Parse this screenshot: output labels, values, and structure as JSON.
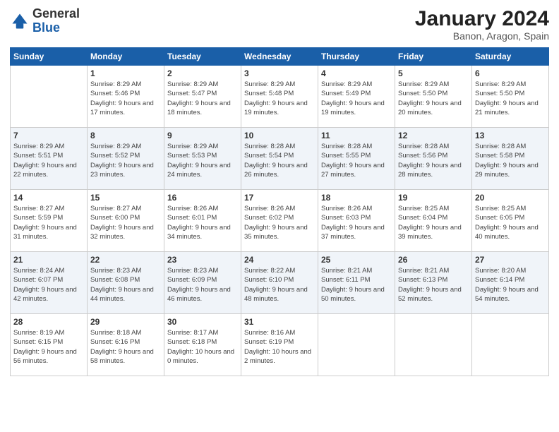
{
  "header": {
    "logo_general": "General",
    "logo_blue": "Blue",
    "title": "January 2024",
    "subtitle": "Banon, Aragon, Spain"
  },
  "days_of_week": [
    "Sunday",
    "Monday",
    "Tuesday",
    "Wednesday",
    "Thursday",
    "Friday",
    "Saturday"
  ],
  "weeks": [
    [
      {
        "day": null
      },
      {
        "day": "1",
        "sunrise": "Sunrise: 8:29 AM",
        "sunset": "Sunset: 5:46 PM",
        "daylight": "Daylight: 9 hours and 17 minutes."
      },
      {
        "day": "2",
        "sunrise": "Sunrise: 8:29 AM",
        "sunset": "Sunset: 5:47 PM",
        "daylight": "Daylight: 9 hours and 18 minutes."
      },
      {
        "day": "3",
        "sunrise": "Sunrise: 8:29 AM",
        "sunset": "Sunset: 5:48 PM",
        "daylight": "Daylight: 9 hours and 19 minutes."
      },
      {
        "day": "4",
        "sunrise": "Sunrise: 8:29 AM",
        "sunset": "Sunset: 5:49 PM",
        "daylight": "Daylight: 9 hours and 19 minutes."
      },
      {
        "day": "5",
        "sunrise": "Sunrise: 8:29 AM",
        "sunset": "Sunset: 5:50 PM",
        "daylight": "Daylight: 9 hours and 20 minutes."
      },
      {
        "day": "6",
        "sunrise": "Sunrise: 8:29 AM",
        "sunset": "Sunset: 5:50 PM",
        "daylight": "Daylight: 9 hours and 21 minutes."
      }
    ],
    [
      {
        "day": "7",
        "sunrise": "Sunrise: 8:29 AM",
        "sunset": "Sunset: 5:51 PM",
        "daylight": "Daylight: 9 hours and 22 minutes."
      },
      {
        "day": "8",
        "sunrise": "Sunrise: 8:29 AM",
        "sunset": "Sunset: 5:52 PM",
        "daylight": "Daylight: 9 hours and 23 minutes."
      },
      {
        "day": "9",
        "sunrise": "Sunrise: 8:29 AM",
        "sunset": "Sunset: 5:53 PM",
        "daylight": "Daylight: 9 hours and 24 minutes."
      },
      {
        "day": "10",
        "sunrise": "Sunrise: 8:28 AM",
        "sunset": "Sunset: 5:54 PM",
        "daylight": "Daylight: 9 hours and 26 minutes."
      },
      {
        "day": "11",
        "sunrise": "Sunrise: 8:28 AM",
        "sunset": "Sunset: 5:55 PM",
        "daylight": "Daylight: 9 hours and 27 minutes."
      },
      {
        "day": "12",
        "sunrise": "Sunrise: 8:28 AM",
        "sunset": "Sunset: 5:56 PM",
        "daylight": "Daylight: 9 hours and 28 minutes."
      },
      {
        "day": "13",
        "sunrise": "Sunrise: 8:28 AM",
        "sunset": "Sunset: 5:58 PM",
        "daylight": "Daylight: 9 hours and 29 minutes."
      }
    ],
    [
      {
        "day": "14",
        "sunrise": "Sunrise: 8:27 AM",
        "sunset": "Sunset: 5:59 PM",
        "daylight": "Daylight: 9 hours and 31 minutes."
      },
      {
        "day": "15",
        "sunrise": "Sunrise: 8:27 AM",
        "sunset": "Sunset: 6:00 PM",
        "daylight": "Daylight: 9 hours and 32 minutes."
      },
      {
        "day": "16",
        "sunrise": "Sunrise: 8:26 AM",
        "sunset": "Sunset: 6:01 PM",
        "daylight": "Daylight: 9 hours and 34 minutes."
      },
      {
        "day": "17",
        "sunrise": "Sunrise: 8:26 AM",
        "sunset": "Sunset: 6:02 PM",
        "daylight": "Daylight: 9 hours and 35 minutes."
      },
      {
        "day": "18",
        "sunrise": "Sunrise: 8:26 AM",
        "sunset": "Sunset: 6:03 PM",
        "daylight": "Daylight: 9 hours and 37 minutes."
      },
      {
        "day": "19",
        "sunrise": "Sunrise: 8:25 AM",
        "sunset": "Sunset: 6:04 PM",
        "daylight": "Daylight: 9 hours and 39 minutes."
      },
      {
        "day": "20",
        "sunrise": "Sunrise: 8:25 AM",
        "sunset": "Sunset: 6:05 PM",
        "daylight": "Daylight: 9 hours and 40 minutes."
      }
    ],
    [
      {
        "day": "21",
        "sunrise": "Sunrise: 8:24 AM",
        "sunset": "Sunset: 6:07 PM",
        "daylight": "Daylight: 9 hours and 42 minutes."
      },
      {
        "day": "22",
        "sunrise": "Sunrise: 8:23 AM",
        "sunset": "Sunset: 6:08 PM",
        "daylight": "Daylight: 9 hours and 44 minutes."
      },
      {
        "day": "23",
        "sunrise": "Sunrise: 8:23 AM",
        "sunset": "Sunset: 6:09 PM",
        "daylight": "Daylight: 9 hours and 46 minutes."
      },
      {
        "day": "24",
        "sunrise": "Sunrise: 8:22 AM",
        "sunset": "Sunset: 6:10 PM",
        "daylight": "Daylight: 9 hours and 48 minutes."
      },
      {
        "day": "25",
        "sunrise": "Sunrise: 8:21 AM",
        "sunset": "Sunset: 6:11 PM",
        "daylight": "Daylight: 9 hours and 50 minutes."
      },
      {
        "day": "26",
        "sunrise": "Sunrise: 8:21 AM",
        "sunset": "Sunset: 6:13 PM",
        "daylight": "Daylight: 9 hours and 52 minutes."
      },
      {
        "day": "27",
        "sunrise": "Sunrise: 8:20 AM",
        "sunset": "Sunset: 6:14 PM",
        "daylight": "Daylight: 9 hours and 54 minutes."
      }
    ],
    [
      {
        "day": "28",
        "sunrise": "Sunrise: 8:19 AM",
        "sunset": "Sunset: 6:15 PM",
        "daylight": "Daylight: 9 hours and 56 minutes."
      },
      {
        "day": "29",
        "sunrise": "Sunrise: 8:18 AM",
        "sunset": "Sunset: 6:16 PM",
        "daylight": "Daylight: 9 hours and 58 minutes."
      },
      {
        "day": "30",
        "sunrise": "Sunrise: 8:17 AM",
        "sunset": "Sunset: 6:18 PM",
        "daylight": "Daylight: 10 hours and 0 minutes."
      },
      {
        "day": "31",
        "sunrise": "Sunrise: 8:16 AM",
        "sunset": "Sunset: 6:19 PM",
        "daylight": "Daylight: 10 hours and 2 minutes."
      },
      {
        "day": null
      },
      {
        "day": null
      },
      {
        "day": null
      }
    ]
  ]
}
